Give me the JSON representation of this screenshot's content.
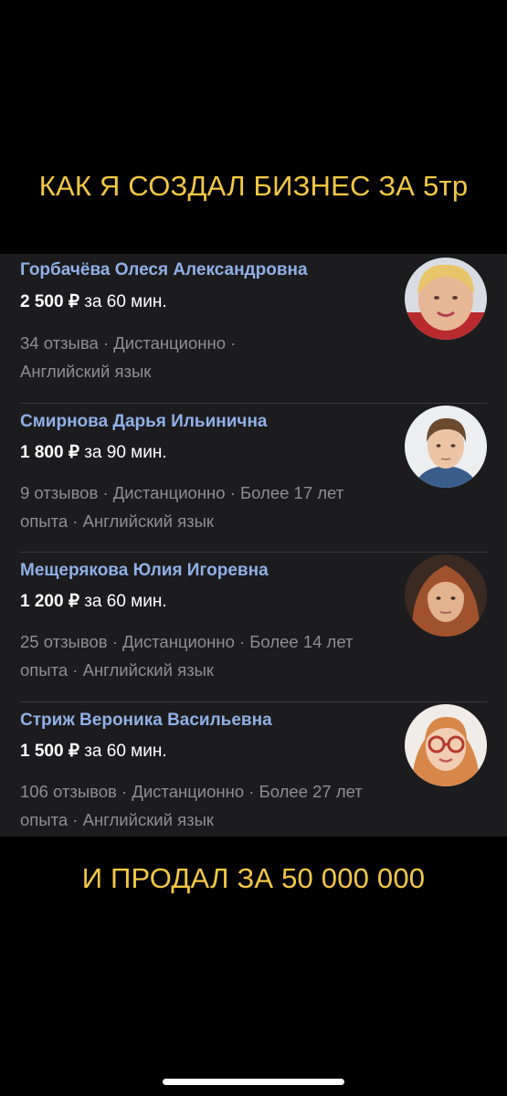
{
  "caption_top": "КАК Я СОЗДАЛ БИЗНЕС ЗА 5тр",
  "caption_bottom": "И ПРОДАЛ ЗА 50 000 000",
  "tutors": [
    {
      "name": "Горбачёва Олеся Александровна",
      "price": "2 500 ₽",
      "duration": "за 60 мин.",
      "meta": "34 отзыва · Дистанционно · Английский язык"
    },
    {
      "name": "Смирнова Дарья Ильинична",
      "price": "1 800 ₽",
      "duration": "за 90 мин.",
      "meta": "9 отзывов · Дистанционно · Более 17 лет опыта · Английский язык"
    },
    {
      "name": "Мещерякова Юлия Игоревна",
      "price": "1 200 ₽",
      "duration": "за 60 мин.",
      "meta": "25 отзывов · Дистанционно · Более 14 лет опыта · Английский язык"
    },
    {
      "name": "Стриж Вероника Васильевна",
      "price": "1 500 ₽",
      "duration": "за 60 мин.",
      "meta": "106 отзывов · Дистанционно · Более 27 лет опыта · Английский язык"
    }
  ],
  "colors": {
    "caption": "#f5c843",
    "name_link": "#8fb0e6",
    "card_bg": "#1c1c1e",
    "meta_text": "#8e8e93"
  }
}
